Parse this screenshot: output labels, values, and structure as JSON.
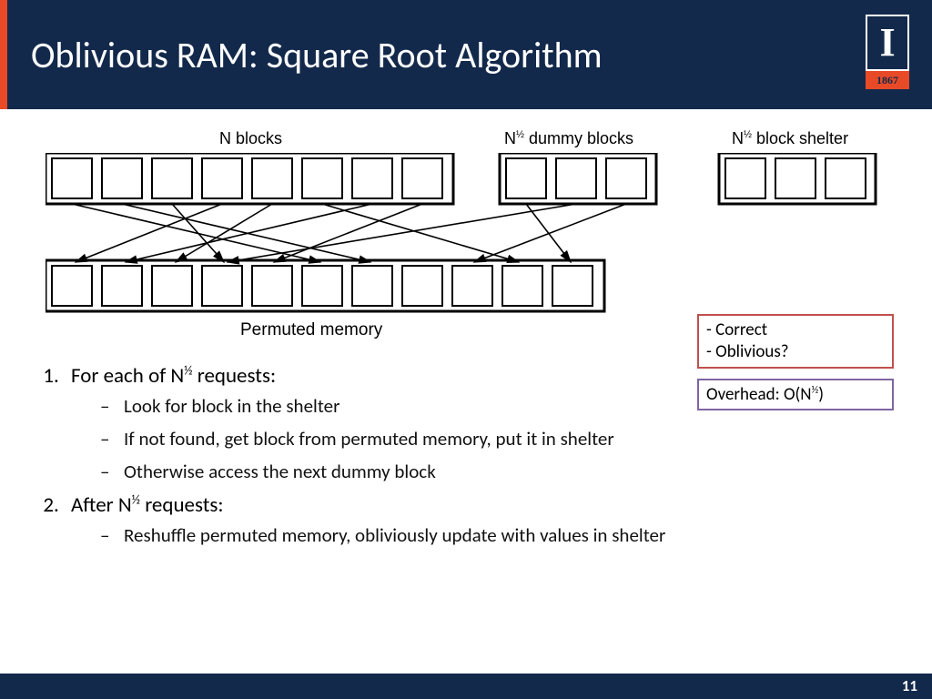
{
  "header": {
    "title": "Oblivious RAM: Square Root Algorithm",
    "logo_letter": "I",
    "logo_year": "1867"
  },
  "labels": {
    "n_blocks": "N blocks",
    "dummy_blocks": "N½ dummy blocks",
    "shelter": "N½ block shelter",
    "permuted": "Permuted memory"
  },
  "box1": {
    "line1": "- Correct",
    "line2": "- Oblivious?"
  },
  "box2": {
    "text": "Overhead: O(N½)"
  },
  "algo": {
    "item1": "For each of N½ requests:",
    "item1a": "Look for block in the shelter",
    "item1b": "If not found, get block from permuted memory, put it in shelter",
    "item1c": "Otherwise access the next dummy block",
    "item2": "After N½ requests:",
    "item2a": "Reshuffle permuted memory, obliviously update with values in shelter"
  },
  "page_number": "11",
  "chart_data": {
    "type": "diagram",
    "top_row": [
      {
        "label": "N blocks",
        "count": 8
      },
      {
        "label": "N½ dummy blocks",
        "count": 3
      },
      {
        "label": "N½ block shelter",
        "count": 3
      }
    ],
    "bottom_row": {
      "label": "Permuted memory",
      "count": 11
    },
    "arrows_from_top_to_bottom_index": [
      [
        0,
        5
      ],
      [
        1,
        6
      ],
      [
        2,
        3
      ],
      [
        3,
        0
      ],
      [
        4,
        2
      ],
      [
        5,
        9
      ],
      [
        6,
        1
      ],
      [
        7,
        4
      ],
      [
        8,
        10
      ],
      [
        9,
        3
      ],
      [
        10,
        8
      ]
    ]
  }
}
